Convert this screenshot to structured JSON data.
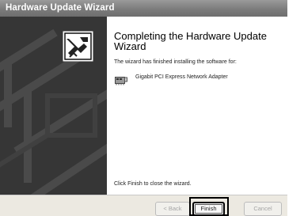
{
  "window": {
    "title": "Hardware Update Wizard"
  },
  "heading": "Completing the Hardware Update Wizard",
  "description": "The wizard has finished installing the software for:",
  "device": {
    "name": "Gigabit PCI Express Network Adapter",
    "icon": "network-adapter-icon"
  },
  "close_instruction": "Click Finish to close the wizard.",
  "buttons": {
    "back": "< Back",
    "finish": "Finish",
    "cancel": "Cancel"
  },
  "colors": {
    "side_panel": "#363636",
    "title_bar": "#8a8a8a",
    "bottom_bar": "#ece9e1"
  }
}
